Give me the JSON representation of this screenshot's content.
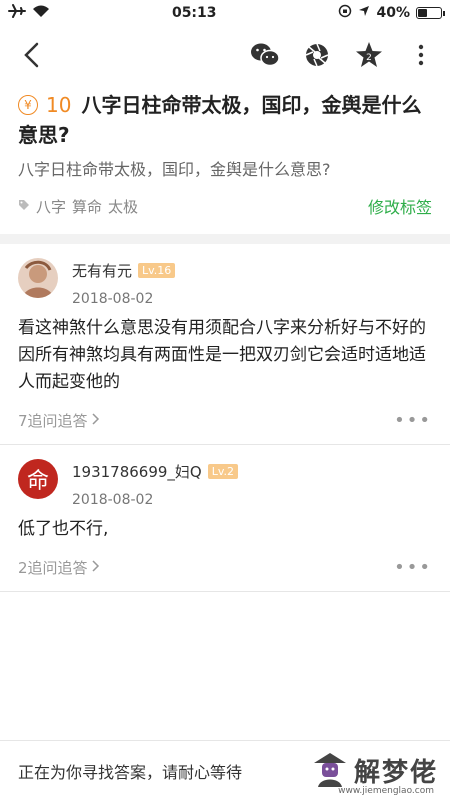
{
  "status_bar": {
    "time": "05:13",
    "battery": "40%",
    "battery_level": 0.4,
    "icons": [
      "airplane-icon",
      "wifi-icon",
      "orientation-lock-icon",
      "location-icon",
      "battery-icon"
    ]
  },
  "nav": {
    "icons": [
      "back-icon",
      "wechat-icon",
      "moments-icon",
      "favorite-icon",
      "more-vertical-icon"
    ]
  },
  "question": {
    "currency_symbol": "¥",
    "bounty": "10",
    "title": "八字日柱命带太极，国印，金舆是什么意思?",
    "description": "八字日柱命带太极，国印，金舆是什么意思?",
    "tags": [
      "八字",
      "算命",
      "太极"
    ],
    "edit_tags_label": "修改标签"
  },
  "answers": [
    {
      "name": "无有有元",
      "level": "Lv.16",
      "date": "2018-08-02",
      "body": "看这神煞什么意思没有用须配合八字来分析好与不好的因所有神煞均具有两面性是一把双刃剑它会适时适地适人而起变他的",
      "followups": "7追问追答",
      "more": "•••"
    },
    {
      "name": "1931786699_妇Q",
      "level": "Lv.2",
      "date": "2018-08-02",
      "body": "低了也不行,",
      "followups": "2追问追答",
      "avatar_char": "命",
      "more": "•••"
    }
  ],
  "bottom": {
    "waiting_text": "正在为你寻找答案，请耐心等待",
    "logo_text": "解梦佬",
    "logo_url": "www.jiemenglao.com"
  },
  "colors": {
    "accent_orange": "#f08a24",
    "accent_green": "#2fae4a",
    "avatar_red": "#c0271f"
  }
}
